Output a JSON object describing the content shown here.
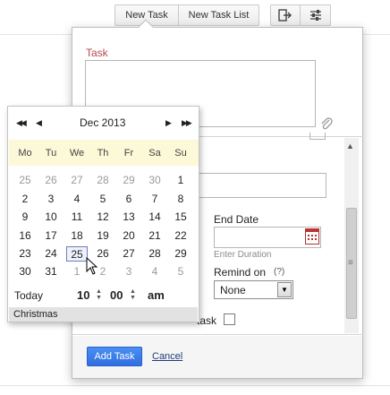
{
  "toolbar": {
    "new_task_label": "New Task",
    "new_task_list_label": "New Task List",
    "export_icon": "export-icon",
    "settings_icon": "settings-sliders-icon"
  },
  "task_form": {
    "task_label": "Task",
    "task_value": "",
    "end_date_label": "End Date",
    "end_date_value": "",
    "duration_hint": "Enter Duration",
    "remind_label": "Remind on",
    "remind_help": "(?)",
    "remind_value": "None",
    "recurring_fragment": "task",
    "add_task_label": "Add Task",
    "cancel_label": "Cancel"
  },
  "calendar": {
    "nav": {
      "first": "◀◀",
      "prev": "◀",
      "next": "▶",
      "last": "▶▶"
    },
    "title": "Dec 2013",
    "weekdays": [
      "Mo",
      "Tu",
      "We",
      "Th",
      "Fr",
      "Sa",
      "Su"
    ],
    "weeks": [
      [
        "25",
        "26",
        "27",
        "28",
        "29",
        "30",
        "1"
      ],
      [
        "2",
        "3",
        "4",
        "5",
        "6",
        "7",
        "8"
      ],
      [
        "9",
        "10",
        "11",
        "12",
        "13",
        "14",
        "15"
      ],
      [
        "16",
        "17",
        "18",
        "19",
        "20",
        "21",
        "22"
      ],
      [
        "23",
        "24",
        "25",
        "26",
        "27",
        "28",
        "29"
      ],
      [
        "30",
        "31",
        "1",
        "2",
        "3",
        "4",
        "5"
      ]
    ],
    "muted_days": [
      [
        0,
        0
      ],
      [
        0,
        1
      ],
      [
        0,
        2
      ],
      [
        0,
        3
      ],
      [
        0,
        4
      ],
      [
        0,
        5
      ],
      [
        5,
        2
      ],
      [
        5,
        3
      ],
      [
        5,
        4
      ],
      [
        5,
        5
      ],
      [
        5,
        6
      ]
    ],
    "selected_day": [
      4,
      2
    ],
    "time": {
      "today_label": "Today",
      "hour": "10",
      "minute": "00",
      "ampm": "am"
    },
    "event": "Christmas"
  },
  "colors": {
    "task_label": "#b54a4a",
    "weekday_bar": "#fbf9d7",
    "add_button": "#3a7be8",
    "cancel_link": "#223a7a"
  }
}
